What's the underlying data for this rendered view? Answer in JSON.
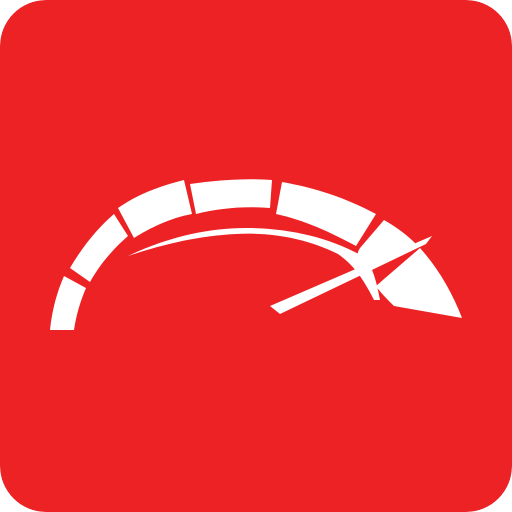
{
  "icon": {
    "name": "speedometer-icon",
    "colors": {
      "background": "#ED2224",
      "foreground": "#FFFFFF"
    },
    "gauge_level": 0.85
  }
}
